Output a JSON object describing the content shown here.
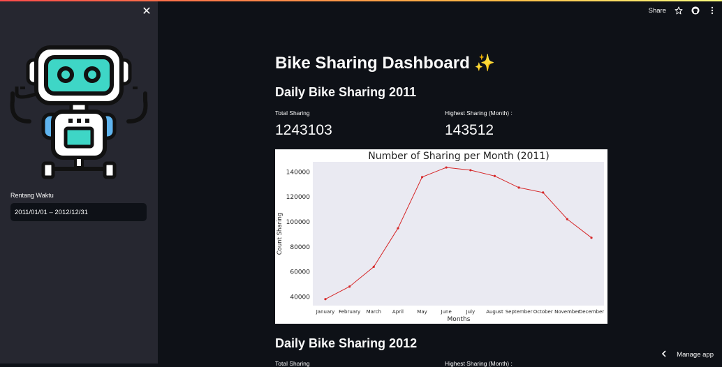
{
  "sidebar": {
    "close_icon": "close-icon",
    "date_label": "Rentang Waktu",
    "date_value": "2011/01/01 – 2012/12/31"
  },
  "header": {
    "share_label": "Share",
    "star_icon": "star-icon",
    "github_icon": "github-icon",
    "menu_icon": "kebab-menu-icon"
  },
  "main": {
    "title": "Bike Sharing Dashboard ✨",
    "section_2011": {
      "heading": "Daily Bike Sharing 2011",
      "total_label": "Total Sharing",
      "total_value": "1243103",
      "highest_label": "Highest Sharing (Month) :",
      "highest_value": "143512"
    },
    "section_2012": {
      "heading": "Daily Bike Sharing 2012",
      "total_label": "Total Sharing",
      "highest_label": "Highest Sharing (Month) :"
    }
  },
  "footer": {
    "manage_label": "Manage app"
  },
  "colors": {
    "accent": "#ff4b4b",
    "plot_bg": "#eaeaf2",
    "line": "#d62728",
    "sidebar_bg": "#262730",
    "app_bg": "#0e1117"
  },
  "chart_data": {
    "type": "line",
    "title": "Number of Sharing per Month (2011)",
    "xlabel": "Months",
    "ylabel": "Count Sharing",
    "categories": [
      "January",
      "February",
      "March",
      "April",
      "May",
      "June",
      "July",
      "August",
      "September",
      "October",
      "November",
      "December"
    ],
    "series": [
      {
        "values": [
          38189,
          48215,
          64045,
          94870,
          135821,
          143512,
          141341,
          136691,
          127418,
          123511,
          102167,
          87323
        ]
      }
    ],
    "yticks": [
      40000,
      60000,
      80000,
      100000,
      120000,
      140000
    ],
    "ylim": [
      33000,
      148000
    ],
    "grid": false
  }
}
